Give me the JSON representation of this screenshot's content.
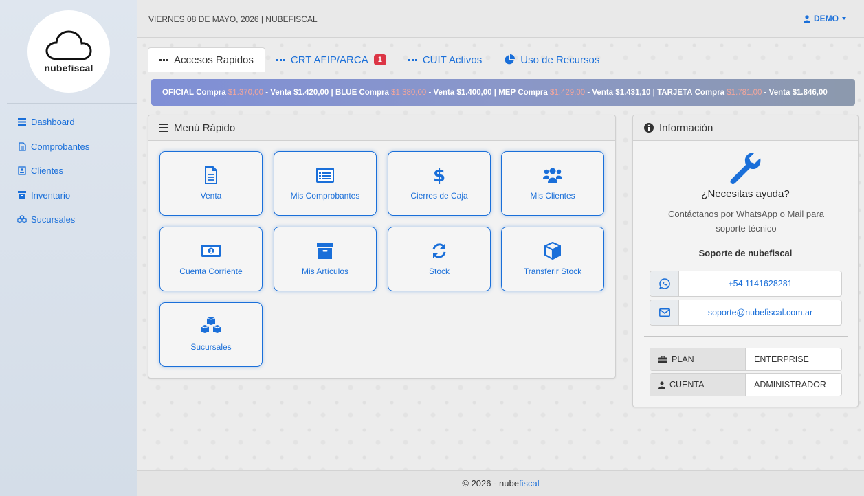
{
  "brand": {
    "logo_text": "nubefiscal"
  },
  "sidebar": {
    "items": [
      {
        "label": "Dashboard",
        "icon": "list-icon"
      },
      {
        "label": "Comprobantes",
        "icon": "file-icon"
      },
      {
        "label": "Clientes",
        "icon": "contact-icon"
      },
      {
        "label": "Inventario",
        "icon": "archive-icon"
      },
      {
        "label": "Sucursales",
        "icon": "cubes-icon"
      }
    ]
  },
  "header": {
    "date": "VIERNES 08 DE MAYO, 2026 | NUBEFISCAL",
    "user": "DEMO"
  },
  "tabs": [
    {
      "label": "Accesos Rapidos",
      "active": true
    },
    {
      "label": "CRT AFIP/ARCA",
      "badge": "1"
    },
    {
      "label": "CUIT Activos"
    },
    {
      "label": "Uso de Recursos"
    }
  ],
  "ticker": {
    "oficial": {
      "name": "OFICIAL",
      "compra": "$1.370,00",
      "venta": "$1.420,00"
    },
    "blue": {
      "name": "BLUE",
      "compra": "$1.380,00",
      "venta": "$1.400,00"
    },
    "mep": {
      "name": "MEP",
      "compra": "$1.429,00",
      "venta": "$1.431,10"
    },
    "tarjeta": {
      "name": "TARJETA",
      "compra": "$1.781,00",
      "venta": "$1.846,00"
    },
    "compra_label": "Compra",
    "venta_label": "- Venta",
    "sep": "|"
  },
  "menu": {
    "title": "Menú Rápido",
    "tiles": [
      {
        "label": "Venta",
        "icon": "document-icon"
      },
      {
        "label": "Mis Comprobantes",
        "icon": "list-alt-icon"
      },
      {
        "label": "Cierres de Caja",
        "icon": "dollar-icon"
      },
      {
        "label": "Mis Clientes",
        "icon": "users-icon"
      },
      {
        "label": "Cuenta Corriente",
        "icon": "money-bill-icon"
      },
      {
        "label": "Mis Artículos",
        "icon": "archive-icon"
      },
      {
        "label": "Stock",
        "icon": "sync-icon"
      },
      {
        "label": "Transferir Stock",
        "icon": "cube-icon"
      },
      {
        "label": "Sucursales",
        "icon": "cubes-icon"
      }
    ]
  },
  "info": {
    "title": "Información",
    "help_title": "¿Necesitas ayuda?",
    "help_sub": "Contáctanos por WhatsApp o Mail para soporte técnico",
    "support_title": "Soporte de nubefiscal",
    "phone": "+54 1141628281",
    "email": "soporte@nubefiscal.com.ar",
    "plan_label": "PLAN",
    "plan_value": "ENTERPRISE",
    "cuenta_label": "CUENTA",
    "cuenta_value": "ADMINISTRADOR"
  },
  "footer": {
    "prefix": "© 2026 - nube",
    "accent": "fiscal"
  },
  "colors": {
    "accent": "#1a6fd9",
    "badge": "#dc3545",
    "ticker_red": "#f3a69c"
  }
}
